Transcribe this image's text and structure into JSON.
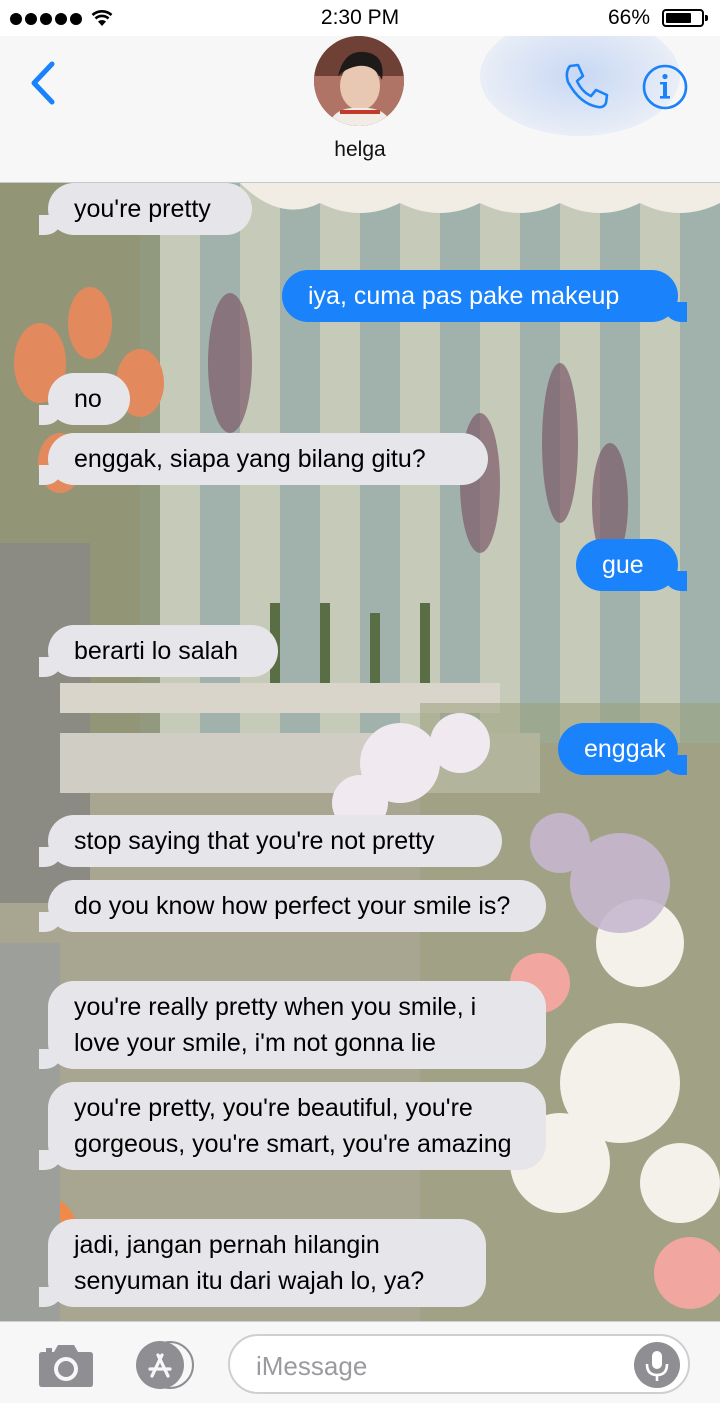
{
  "status_bar": {
    "time": "2:30 PM",
    "battery_percent": "66%",
    "battery_level": 0.66,
    "signal_dots": 5,
    "wifi_icon": "wifi-icon"
  },
  "header": {
    "contact_name": "helga",
    "back_icon": "chevron-left-icon",
    "call_icon": "phone-icon",
    "info_icon": "info-icon",
    "accent_color": "#1a82fb"
  },
  "messages": [
    {
      "direction": "in",
      "text": "you're pretty"
    },
    {
      "direction": "out",
      "text": "iya, cuma pas pake makeup"
    },
    {
      "direction": "in",
      "text": "no"
    },
    {
      "direction": "in",
      "text": "enggak, siapa yang bilang gitu?"
    },
    {
      "direction": "out",
      "text": "gue"
    },
    {
      "direction": "in",
      "text": "berarti lo salah"
    },
    {
      "direction": "out",
      "text": "enggak"
    },
    {
      "direction": "in",
      "text": "stop saying that you're not pretty"
    },
    {
      "direction": "in",
      "text": "do you know how perfect your smile is?"
    },
    {
      "direction": "in",
      "text": "you're really pretty when you smile, i love your smile, i'm not gonna lie"
    },
    {
      "direction": "in",
      "text": "you're pretty, you're beautiful, you're gorgeous, you're smart, you're amazing"
    },
    {
      "direction": "in",
      "text": "jadi, jangan pernah hilangin senyuman itu dari wajah lo, ya?"
    }
  ],
  "colors": {
    "incoming_bubble": "#e6e5ea",
    "outgoing_bubble": "#1a82fb"
  },
  "input_bar": {
    "placeholder": "iMessage",
    "camera_icon": "camera-icon",
    "apps_icon": "app-store-icon",
    "mic_icon": "microphone-icon"
  }
}
